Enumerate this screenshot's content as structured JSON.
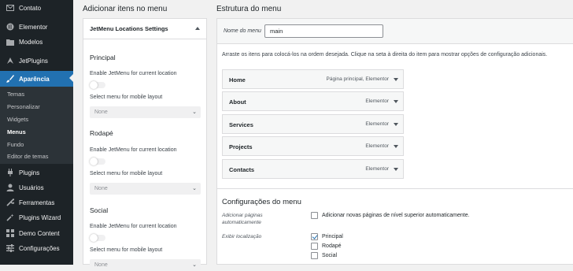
{
  "sidebar": {
    "items": [
      {
        "label": "Contato",
        "icon": "envelope-icon"
      },
      {
        "label": "Elementor",
        "icon": "elementor-icon"
      },
      {
        "label": "Modelos",
        "icon": "folder-icon"
      },
      {
        "label": "JetPlugins",
        "icon": "jetplugins-icon"
      },
      {
        "label": "Aparência",
        "icon": "paintbrush-icon"
      },
      {
        "label": "Plugins",
        "icon": "plug-icon"
      },
      {
        "label": "Usuários",
        "icon": "user-icon"
      },
      {
        "label": "Ferramentas",
        "icon": "wrench-icon"
      },
      {
        "label": "Plugins Wizard",
        "icon": "wizard-icon"
      },
      {
        "label": "Demo Content",
        "icon": "grid-icon"
      },
      {
        "label": "Configurações",
        "icon": "settings-icon"
      }
    ],
    "submenu": [
      "Temas",
      "Personalizar",
      "Widgets",
      "Menus",
      "Fundo",
      "Editor de temas"
    ]
  },
  "left": {
    "heading": "Adicionar itens no menu",
    "accordion_title": "JetMenu Locations Settings",
    "locations": [
      {
        "title": "Principal",
        "enable_label": "Enable JetMenu for current location",
        "select_label": "Select menu for mobile layout",
        "select_value": "None"
      },
      {
        "title": "Rodapé",
        "enable_label": "Enable JetMenu for current location",
        "select_label": "Select menu for mobile layout",
        "select_value": "None"
      },
      {
        "title": "Social",
        "enable_label": "Enable JetMenu for current location",
        "select_label": "Select menu for mobile layout",
        "select_value": "None"
      }
    ]
  },
  "right": {
    "heading": "Estrutura do menu",
    "name_label": "Nome do menu",
    "name_value": "main",
    "instructions": "Arraste os itens para colocá-los na ordem desejada. Clique na seta à direita do item para mostrar opções de configuração adicionais.",
    "menu_items": [
      {
        "title": "Home",
        "kind": "Página principal, Elementor"
      },
      {
        "title": "About",
        "kind": "Elementor"
      },
      {
        "title": "Services",
        "kind": "Elementor"
      },
      {
        "title": "Projects",
        "kind": "Elementor"
      },
      {
        "title": "Contacts",
        "kind": "Elementor"
      }
    ],
    "settings_title": "Configurações do menu",
    "auto_add_label": "Adicionar páginas automaticamente",
    "auto_add_option": "Adicionar novas páginas de nível superior automaticamente.",
    "auto_add_checked": false,
    "locations_label": "Exibir localização",
    "location_options": [
      {
        "label": "Principal",
        "checked": true
      },
      {
        "label": "Rodapé",
        "checked": false
      },
      {
        "label": "Social",
        "checked": false
      }
    ]
  },
  "colors": {
    "sidebar_bg": "#1d2327",
    "accent": "#2271b1",
    "page_bg": "#f1f1f1"
  }
}
